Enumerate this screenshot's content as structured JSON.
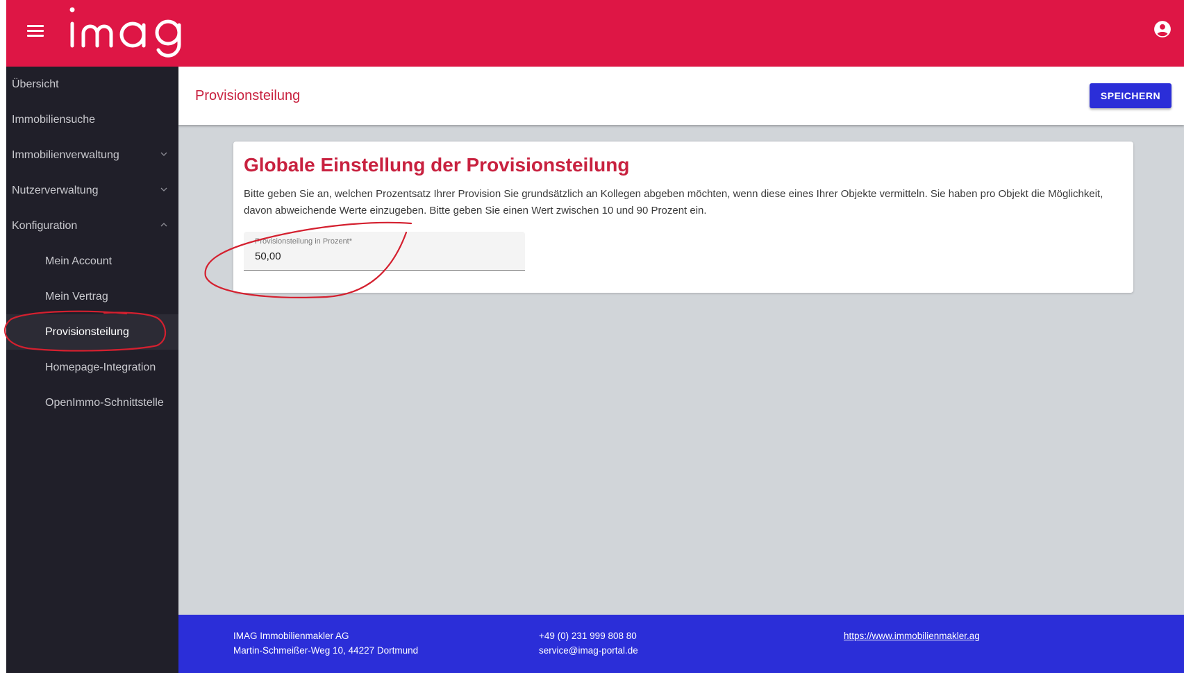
{
  "app": {
    "logo_text": "imag",
    "colors": {
      "brand": "#de1645",
      "sidebar": "#201f29",
      "accent_blue": "#2b2ed8",
      "title_red": "#c8213f",
      "content_bg": "#d1d5d9"
    }
  },
  "topbar": {
    "menu_icon": "hamburger-menu-icon",
    "account_icon": "account-circle-icon"
  },
  "sidebar": {
    "items": [
      {
        "label": "Übersicht",
        "level": 0
      },
      {
        "label": "Immobiliensuche",
        "level": 0
      },
      {
        "label": "Immobilienverwaltung",
        "level": 0,
        "expanded": false
      },
      {
        "label": "Nutzerverwaltung",
        "level": 0,
        "expanded": false
      },
      {
        "label": "Konfiguration",
        "level": 0,
        "expanded": true
      },
      {
        "label": "Mein Account",
        "level": 1
      },
      {
        "label": "Mein Vertrag",
        "level": 1
      },
      {
        "label": "Provisionsteilung",
        "level": 1,
        "active": true
      },
      {
        "label": "Homepage-Integration",
        "level": 1
      },
      {
        "label": "OpenImmo-Schnittstelle",
        "level": 1
      }
    ]
  },
  "header": {
    "title": "Provisionsteilung",
    "save_label": "SPEICHERN"
  },
  "card": {
    "title": "Globale Einstellung der Provisionsteilung",
    "description": "Bitte geben Sie an, welchen Prozentsatz Ihrer Provision Sie grundsätzlich an Kollegen abgeben möchten, wenn diese eines Ihrer Objekte vermitteln. Sie haben pro Objekt die Möglichkeit, davon abweichende Werte einzugeben. Bitte geben Sie einen Wert zwischen 10 und 90 Prozent ein.",
    "field": {
      "label": "Provisionsteilung in Prozent*",
      "value": "50,00"
    }
  },
  "footer": {
    "company": "IMAG Immobilienmakler AG",
    "address": "Martin-Schmeißer-Weg 10, 44227 Dortmund",
    "phone": "+49 (0) 231 999 808 80",
    "email": "service@imag-portal.de",
    "website": "https://www.immobilienmakler.ag"
  }
}
